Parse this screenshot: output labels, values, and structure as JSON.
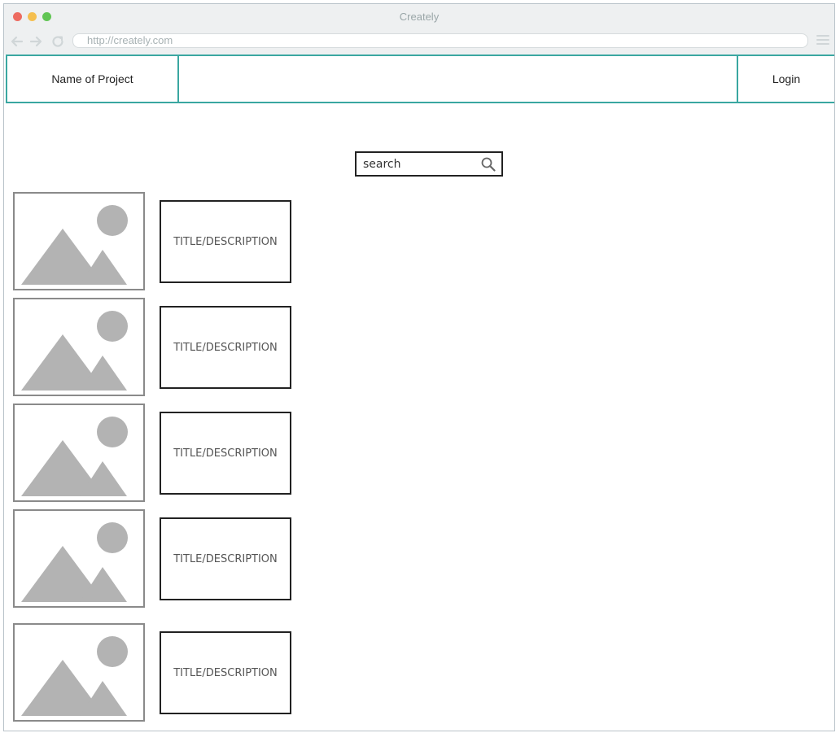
{
  "window": {
    "title": "Creately",
    "url": "http://creately.com"
  },
  "header": {
    "project_name": "Name of Project",
    "login_label": "Login"
  },
  "search": {
    "placeholder": "search",
    "icon": "search-icon"
  },
  "items": [
    {
      "image": "image-placeholder-icon",
      "label": "TITLE/DESCRIPTION"
    },
    {
      "image": "image-placeholder-icon",
      "label": "TITLE/DESCRIPTION"
    },
    {
      "image": "image-placeholder-icon",
      "label": "TITLE/DESCRIPTION"
    },
    {
      "image": "image-placeholder-icon",
      "label": "TITLE/DESCRIPTION"
    },
    {
      "image": "image-placeholder-icon",
      "label": "TITLE/DESCRIPTION"
    }
  ],
  "colors": {
    "accent": "#3aa7a1",
    "placeholder_fill": "#b3b3b3"
  }
}
